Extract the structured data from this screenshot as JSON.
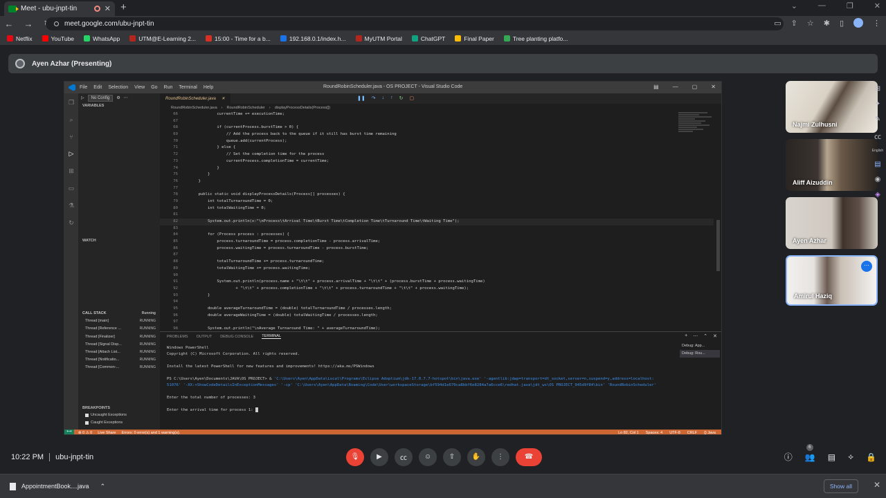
{
  "browser": {
    "tab_title": "Meet - ubu-jnpt-tin",
    "url": "meet.google.com/ubu-jnpt-tin",
    "bookmarks": [
      {
        "label": "Netflix",
        "color": "#e50914"
      },
      {
        "label": "YouTube",
        "color": "#ff0000"
      },
      {
        "label": "WhatsApp",
        "color": "#25d366"
      },
      {
        "label": "UTM@E-Learning 2...",
        "color": "#b3261e"
      },
      {
        "label": "15:00 - Time for a b...",
        "color": "#d93025"
      },
      {
        "label": "192.168.0.1/index.h...",
        "color": "#1a73e8"
      },
      {
        "label": "MyUTM Portal",
        "color": "#b3261e"
      },
      {
        "label": "ChatGPT",
        "color": "#10a37f"
      },
      {
        "label": "Final Paper",
        "color": "#fbbc04"
      },
      {
        "label": "Tree planting platfo...",
        "color": "#34a853"
      }
    ]
  },
  "meet": {
    "presenting_label": "Ayen Azhar (Presenting)",
    "time": "10:22 PM",
    "meeting_code": "ubu-jnpt-tin",
    "participants_count": "6",
    "participants": [
      {
        "name": "Najmi Zulhusni"
      },
      {
        "name": "Aliff Aizuddin"
      },
      {
        "name": "Ayen Azhar"
      },
      {
        "name": "Amirul Haziq"
      }
    ],
    "side_tools_caption": "English"
  },
  "vscode": {
    "menu": [
      "File",
      "Edit",
      "Selection",
      "View",
      "Go",
      "Run",
      "Terminal",
      "Help"
    ],
    "window_title": "RoundRobinScheduler.java - OS PROJECT - Visual Studio Code",
    "debug_config": "No Config",
    "variables_header": "VARIABLES",
    "watch_header": "WATCH",
    "callstack_header": "CALL STACK",
    "callstack_state": "Running",
    "threads": [
      {
        "name": "Thread [main]",
        "state": "RUNNING"
      },
      {
        "name": "Thread [Reference ...",
        "state": "RUNNING"
      },
      {
        "name": "Thread [Finalizer]",
        "state": "RUNNING"
      },
      {
        "name": "Thread [Signal Disp...",
        "state": "RUNNING"
      },
      {
        "name": "Thread [Attach List...",
        "state": "RUNNING"
      },
      {
        "name": "Thread [Notificatio...",
        "state": "RUNNING"
      },
      {
        "name": "Thread [Common-...",
        "state": "RUNNING"
      }
    ],
    "breakpoints_header": "BREAKPOINTS",
    "breakpoints": [
      "Uncaught Exceptions",
      "Caught Exceptions"
    ],
    "editor_tab": "RoundRobinScheduler.java",
    "breadcrumb": [
      "RoundRobinScheduler.java",
      "RoundRobinScheduler",
      "displayProcessDetails(Process[])"
    ],
    "code_lines": [
      {
        "n": "66",
        "t": "            currentTime += executionTime;"
      },
      {
        "n": "67",
        "t": ""
      },
      {
        "n": "68",
        "t": "            if (currentProcess.burstTime > 0) {"
      },
      {
        "n": "69",
        "t": "                // Add the process back to the queue if it still has burst time remaining"
      },
      {
        "n": "70",
        "t": "                queue.add(currentProcess);"
      },
      {
        "n": "71",
        "t": "            } else {"
      },
      {
        "n": "72",
        "t": "                // Set the completion time for the process"
      },
      {
        "n": "73",
        "t": "                currentProcess.completionTime = currentTime;"
      },
      {
        "n": "74",
        "t": "            }"
      },
      {
        "n": "75",
        "t": "        }"
      },
      {
        "n": "76",
        "t": "    }"
      },
      {
        "n": "77",
        "t": ""
      },
      {
        "n": "78",
        "t": "    public static void displayProcessDetails(Process[] processes) {"
      },
      {
        "n": "79",
        "t": "        int totalTurnaroundTime = 0;"
      },
      {
        "n": "80",
        "t": "        int totalWaitingTime = 0;"
      },
      {
        "n": "81",
        "t": ""
      },
      {
        "n": "82",
        "t": "        System.out.println(x:\"\\nProcess\\tArrival Time\\tBurst Time\\tCompletion Time\\tTurnaround Time\\tWaiting Time\");"
      },
      {
        "n": "83",
        "t": ""
      },
      {
        "n": "84",
        "t": "        for (Process process : processes) {"
      },
      {
        "n": "85",
        "t": "            process.turnaroundTime = process.completionTime - process.arrivalTime;"
      },
      {
        "n": "86",
        "t": "            process.waitingTime = process.turnaroundTime - process.burstTime;"
      },
      {
        "n": "87",
        "t": ""
      },
      {
        "n": "88",
        "t": "            totalTurnaroundTime += process.turnaroundTime;"
      },
      {
        "n": "89",
        "t": "            totalWaitingTime += process.waitingTime;"
      },
      {
        "n": "90",
        "t": ""
      },
      {
        "n": "91",
        "t": "            System.out.println(process.name + \"\\t\\t\" + process.arrivalTime + \"\\t\\t\" + (process.burstTime + process.waitingTime)"
      },
      {
        "n": "92",
        "t": "                    + \"\\t\\t\" + process.completionTime + \"\\t\\t\" + process.turnaroundTime + \"\\t\\t\" + process.waitingTime);"
      },
      {
        "n": "93",
        "t": "        }"
      },
      {
        "n": "94",
        "t": ""
      },
      {
        "n": "95",
        "t": "        double averageTurnaroundTime = (double) totalTurnaroundTime / processes.length;"
      },
      {
        "n": "96",
        "t": "        double averageWaitingTime = (double) totalWaitingTime / processes.length;"
      },
      {
        "n": "97",
        "t": ""
      },
      {
        "n": "98",
        "t": "        System.out.println(\"\\nAverage Turnaround Time: \" + averageTurnaroundTime);"
      }
    ],
    "panel_tabs": [
      "PROBLEMS",
      "OUTPUT",
      "DEBUG CONSOLE",
      "TERMINAL"
    ],
    "terminal": {
      "line1": "Windows PowerShell",
      "line2": "Copyright (C) Microsoft Corporation. All rights reserved.",
      "line3": "Install the latest PowerShell for new features and improvements! https://aka.ms/PSWindows",
      "prompt": "PS C:\\Users\\Ayen\\Documents\\JAVA\\OS PROJECT> &",
      "cmd1": " 'C:\\Users\\Ayen\\AppData\\Local\\Programs\\Eclipse Adoptium\\jdk-17.0.7.7-hotspot\\bin\\java.exe' '-agentlib:jdwp=transport=dt_socket,server=n,suspend=y,address=localhost:",
      "cmd2": "51076' '-XX:+ShowCodeDetailsInExceptionMessages' '-cp' 'C:\\Users\\Ayen\\AppData\\Roaming\\Code\\User\\workspaceStorage\\bf594d1e670ca8bbf6e8284a7a6cce6\\redhat.java\\jdt_ws\\OS PROJECT_945d9f84\\bin' 'RoundRobinScheduler'",
      "q1": "Enter the total number of processes: 3",
      "q2": "Enter the arrival time for process 1: "
    },
    "terminal_list": [
      "Debug: App...",
      "Debug: Rou..."
    ],
    "status_left": [
      "⊗ 0 ⚠ 0",
      "Live Share",
      "Errors: 0 error(s) and 1 warning(s)."
    ],
    "status_right": [
      "Ln 82, Col 1",
      "Spaces: 4",
      "UTF-8",
      "CRLF",
      "{} Java"
    ]
  },
  "downloads": {
    "file": "AppointmentBook....java",
    "show_all": "Show all"
  }
}
